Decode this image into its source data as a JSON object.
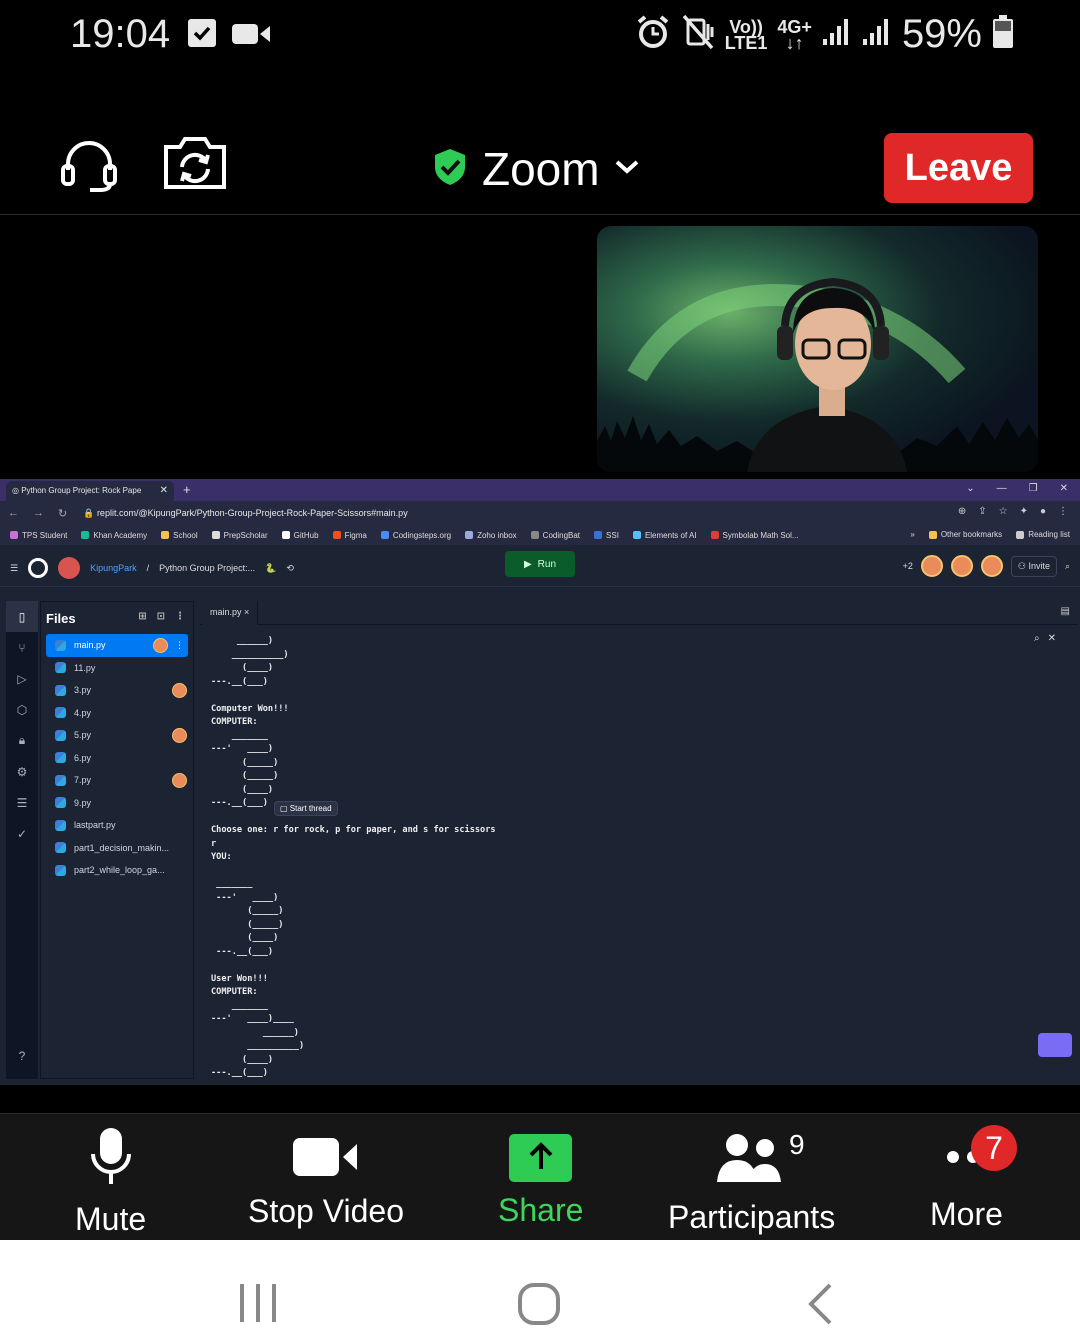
{
  "status_bar": {
    "time": "19:04",
    "net_top": "Vo))",
    "net_bottom": "LTE1",
    "net_type": "4G+",
    "battery": "59%"
  },
  "zoom_header": {
    "title": "Zoom",
    "leave_label": "Leave",
    "secure_color": "#2ecc55"
  },
  "browser": {
    "tab_title": "Python Group Project: Rock Pape",
    "url": "replit.com/@KipungPark/Python-Group-Project-Rock-Paper-Scissors#main.py",
    "bookmarks": [
      "TPS Student",
      "Khan Academy",
      "School",
      "PrepScholar",
      "GitHub",
      "Figma",
      "Codingsteps.org",
      "Zoho inbox",
      "CodingBat",
      "SSI",
      "Elements of AI",
      "Symbolab Math Sol..."
    ],
    "bookmarks_more": "»",
    "other_bookmarks": "Other bookmarks",
    "reading_list": "Reading list"
  },
  "replit": {
    "user": "KipungPark",
    "separator": "/",
    "project": "Python Group Project:...",
    "run_label": "Run",
    "extra_users": "+2",
    "invite_label": "Invite",
    "files_title": "Files",
    "files": [
      "main.py",
      "11.py",
      "3.py",
      "4.py",
      "5.py",
      "6.py",
      "7.py",
      "9.py",
      "lastpart.py",
      "part1_decision_makin...",
      "part2_while_loop_ga..."
    ],
    "editor_tab": "main.py",
    "thread_chip": "Start thread",
    "console": "     ______)\n    __________)\n      (____)\n---.__(___)\n\nComputer Won!!!\nCOMPUTER:\n    _______\n---'   ____)\n      (_____)\n      (_____)\n      (____)\n---.__(___)\n\nChoose one: r for rock, p for paper, and s for scissors\nr\nYOU:\n\n _______\n ---'   ____)\n       (_____)\n       (_____)\n       (____)\n ---.__(___)\n\nUser Won!!!\nCOMPUTER:\n    _______\n---'   ____)____\n          ______)\n       __________)\n      (____)\n---.__(___)"
  },
  "bottom_bar": {
    "mute": "Mute",
    "stop_video": "Stop Video",
    "share": "Share",
    "participants": "Participants",
    "participants_count": "9",
    "more": "More",
    "more_badge": "7",
    "share_color": "#2ecc55"
  }
}
